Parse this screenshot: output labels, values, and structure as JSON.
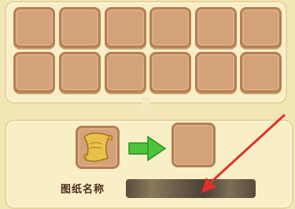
{
  "crafting": {
    "slot_rows": 2,
    "slot_columns": 6,
    "recipe_name_label": "图纸名称",
    "recipe_name_value": ""
  },
  "icons": {
    "down_arrow": "down-arrow-icon",
    "scroll": "scroll-icon",
    "convert_arrow": "right-arrow-icon"
  },
  "colors": {
    "panel": "#f9efc6",
    "slot": "#d3a278",
    "arrow_green": "#4cc53a",
    "pointer_red": "#e0312b"
  }
}
